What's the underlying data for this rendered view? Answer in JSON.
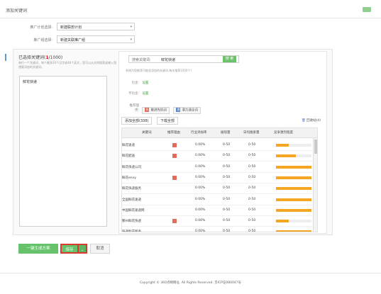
{
  "window": {
    "title": "添加关键词"
  },
  "filters": {
    "campaign_label": "推广计划选择:",
    "campaign_value": "新建联想计划",
    "unit_label": "推广组选择:",
    "unit_value": "新建关联推广组"
  },
  "selected": {
    "title_prefix": "已选择关键词(",
    "count": "1",
    "title_suffix": "/1000)",
    "desc": "每行一个关键词，每个最多20个汉字或40个英文，您可以从右侧搜索或输入您想要添加的关键词。",
    "keywords_text": "鲜花快递"
  },
  "search": {
    "label": "搜索关键词:",
    "value": "鲜花快递",
    "button": "搜 索"
  },
  "suggest_desc": "系统为您推荐可能会添加的关键词,每次推荐1000个!",
  "options": {
    "include_label": "包含:",
    "include_value": "设置",
    "exclude_label": "不包含:",
    "exclude_value": "设置",
    "recommend_label": "推荐理由:",
    "recommend_btn1": "推进先机词",
    "recommend_btn2": "潜力通全词"
  },
  "tabs": {
    "add_all": "添加全部(338)",
    "download_all": "下载全部"
  },
  "recycle": "回收站(4)",
  "table": {
    "headers": [
      "关键词",
      "推荐理由",
      "行业添加率",
      "展现量",
      "日均搜索量",
      "竞争激烈程度"
    ],
    "rows": [
      {
        "keyword": "鲜花速递",
        "badge": true,
        "rate": "0.00%",
        "impr": "0-50",
        "daily": "0-50",
        "competition": 0.35
      },
      {
        "keyword": "鲜花配送",
        "badge": true,
        "rate": "0.00%",
        "impr": "0-50",
        "daily": "0-50",
        "competition": 0.55
      },
      {
        "keyword": "鲜花快递公司",
        "badge": false,
        "rate": "0.00%",
        "impr": "0-50",
        "daily": "0-50",
        "competition": 1.0
      },
      {
        "keyword": "鲜花envy",
        "badge": true,
        "rate": "0.00%",
        "impr": "0-50",
        "daily": "0-50",
        "competition": 1.0
      },
      {
        "keyword": "鲜花快递服务",
        "badge": false,
        "rate": "0.00%",
        "impr": "0-50",
        "daily": "0-50",
        "competition": 1.0
      },
      {
        "keyword": "全国鲜花速递",
        "badge": false,
        "rate": "0.00%",
        "impr": "0-50",
        "daily": "0-50",
        "competition": 1.0
      },
      {
        "keyword": "中国鲜花速递网",
        "badge": false,
        "rate": "0.00%",
        "impr": "0-50",
        "daily": "0-50",
        "competition": 1.0
      },
      {
        "keyword": "鄞州鲜花快递",
        "badge": true,
        "rate": "0.00%",
        "impr": "0-50",
        "daily": "0-50",
        "competition": 0.35
      },
      {
        "keyword": "快递鲜花服务",
        "badge": false,
        "rate": "0.00%",
        "impr": "0-50",
        "daily": "0-50",
        "competition": 1.0
      }
    ]
  },
  "buttons": {
    "generate": "一键生成方案",
    "save": "保存",
    "save_dropdown": "⌄",
    "cancel": "取消"
  },
  "footer": "Copyright © 360点睛网址. All Rights Reserved. 京ICP证080047号",
  "colors": {
    "accent_green": "#67c36b",
    "badge_red": "#e06d5b",
    "bar_orange": "#f5a623",
    "highlight_red": "#d93a2f"
  }
}
